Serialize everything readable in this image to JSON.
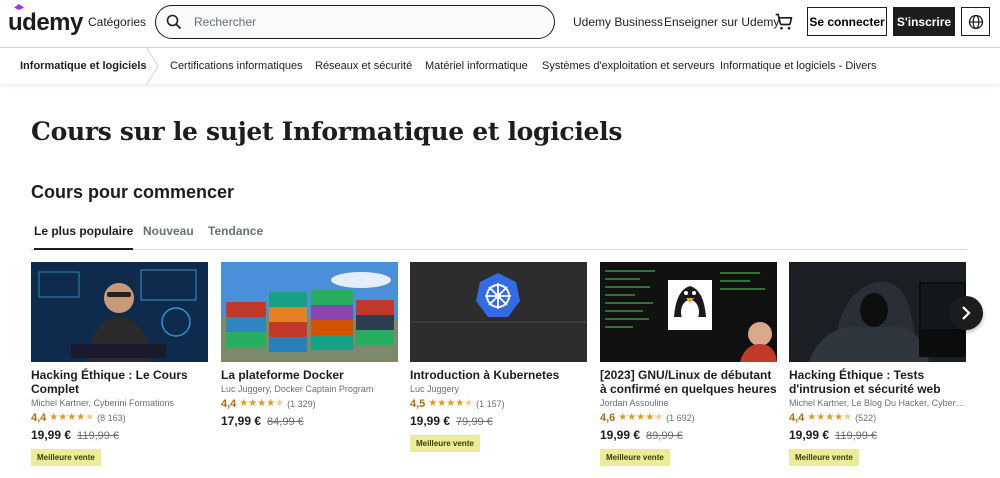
{
  "header": {
    "logo": "udemy",
    "categories": "Catégories",
    "search_placeholder": "Rechercher",
    "business": "Udemy Business",
    "teach": "Enseigner sur Udemy",
    "login": "Se connecter",
    "signup": "S'inscrire"
  },
  "subnav": {
    "current": "Informatique et logiciels",
    "items": [
      "Certifications informatiques",
      "Réseaux et sécurité",
      "Matériel informatique",
      "Systèmes d'exploitation et serveurs",
      "Informatique et logiciels - Divers"
    ]
  },
  "page_title": "Cours sur le sujet Informatique et logiciels",
  "section_title": "Cours pour commencer",
  "tabs": [
    "Le plus populaire",
    "Nouveau",
    "Tendance"
  ],
  "courses": [
    {
      "title": "Hacking Éthique : Le Cours Complet",
      "author": "Michel Kartner, Cyberini Formations",
      "rating": "4,4",
      "rating_value": 4.4,
      "count": "(8 163)",
      "price": "19,99 €",
      "old_price": "119,99 €",
      "badge": "Meilleure vente"
    },
    {
      "title": "La plateforme Docker",
      "author": "Luc Juggery, Docker Captain Program",
      "rating": "4,4",
      "rating_value": 4.4,
      "count": "(1 329)",
      "price": "17,99 €",
      "old_price": "84,99 €",
      "badge": ""
    },
    {
      "title": "Introduction à Kubernetes",
      "author": "Luc Juggery",
      "rating": "4,5",
      "rating_value": 4.5,
      "count": "(1 157)",
      "price": "19,99 €",
      "old_price": "79,99 €",
      "badge": "Meilleure vente"
    },
    {
      "title": "[2023] GNU/Linux de débutant à confirmé en quelques heures",
      "author": "Jordan Assouline",
      "rating": "4,6",
      "rating_value": 4.6,
      "count": "(1 692)",
      "price": "19,99 €",
      "old_price": "89,99 €",
      "badge": "Meilleure vente"
    },
    {
      "title": "Hacking Éthique : Tests d'intrusion et sécurité web",
      "author": "Michel Kartner, Le Blog Du Hacker, Cyberini...",
      "rating": "4,4",
      "rating_value": 4.4,
      "count": "(522)",
      "price": "19,99 €",
      "old_price": "119,99 €",
      "badge": "Meilleure vente"
    }
  ],
  "colors": {
    "brand": "#a435f0",
    "text": "#1c1d1f",
    "rating": "#b4690e",
    "star": "#e59819",
    "badge_bg": "#eceb98"
  }
}
